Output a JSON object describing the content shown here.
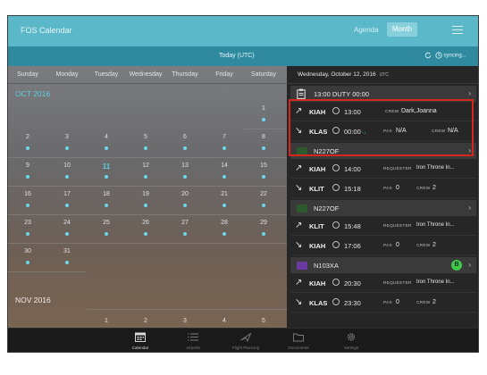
{
  "header": {
    "app_title": "FOS Calendar",
    "nav_agenda": "Agenda",
    "nav_month": "Month",
    "menu_icon": "hamburger-menu-icon"
  },
  "today_bar": {
    "label": "Today (UTC)",
    "sync_text": "syncing..."
  },
  "calendar": {
    "weekdays": [
      "Sunday",
      "Monday",
      "Tuesday",
      "Wednesday",
      "Thursday",
      "Friday",
      "Saturday"
    ],
    "month1_label": "OCT 2016",
    "month2_label": "NOV 2016",
    "today_day": "11",
    "oct_rows": [
      [
        "",
        "",
        "",
        "",
        "",
        "",
        "1"
      ],
      [
        "2",
        "3",
        "4",
        "5",
        "6",
        "7",
        "8"
      ],
      [
        "9",
        "10",
        "11",
        "12",
        "13",
        "14",
        "15"
      ],
      [
        "16",
        "17",
        "18",
        "19",
        "20",
        "21",
        "22"
      ],
      [
        "23",
        "24",
        "25",
        "26",
        "27",
        "28",
        "29"
      ],
      [
        "30",
        "31",
        "",
        "",
        "",
        "",
        ""
      ]
    ],
    "nov_row": [
      "",
      "",
      "1",
      "2",
      "3",
      "4",
      "5"
    ]
  },
  "panel": {
    "date": "Wednesday, October 12, 2016",
    "date_tz": "UTC",
    "duty": {
      "title": "13:00 DUTY 00:00",
      "dep_airport": "KIAH",
      "dep_time": "13:00",
      "crew_label": "CREW",
      "crew_value": "Dark,Joanna",
      "arr_airport": "KLAS",
      "arr_time": "00:00",
      "arr_time_suffix": "+1",
      "pax_label": "PAX",
      "pax_value": "N/A",
      "crew2_label": "CREW",
      "crew2_value": "N/A"
    },
    "flights": [
      {
        "tail": "N227OF",
        "color": "#2e5a2e",
        "badge": "",
        "dep_airport": "KIAH",
        "dep_time": "14:00",
        "req_label": "REQUESTER",
        "req_value": "Iron Throne In...",
        "arr_airport": "KLIT",
        "arr_time": "15:18",
        "pax_label": "PAX",
        "pax_value": "0",
        "crew_label": "CREW",
        "crew_value": "2"
      },
      {
        "tail": "N227OF",
        "color": "#2e5a2e",
        "badge": "",
        "dep_airport": "KLIT",
        "dep_time": "15:48",
        "req_label": "REQUESTER",
        "req_value": "Iron Throne In...",
        "arr_airport": "KIAH",
        "arr_time": "17:06",
        "pax_label": "PAX",
        "pax_value": "0",
        "crew_label": "CREW",
        "crew_value": "2"
      },
      {
        "tail": "N103XA",
        "color": "#6a3aa0",
        "badge": "B",
        "dep_airport": "KIAH",
        "dep_time": "20:30",
        "req_label": "REQUESTER",
        "req_value": "Iron Throne In...",
        "arr_airport": "KLAS",
        "arr_time": "23:30",
        "pax_label": "PAX",
        "pax_value": "0",
        "crew_label": "CREW",
        "crew_value": "2"
      }
    ]
  },
  "tabs": [
    {
      "label": "Calendar",
      "icon": "calendar-icon",
      "active": true
    },
    {
      "label": "Airports",
      "icon": "list-icon",
      "active": false
    },
    {
      "label": "Flight Planning",
      "icon": "plane-icon",
      "active": false
    },
    {
      "label": "Documents",
      "icon": "folder-icon",
      "active": false
    },
    {
      "label": "Settings",
      "icon": "gear-icon",
      "active": false
    }
  ],
  "colors": {
    "accent": "#5bb8c9",
    "accent_dark": "#2f8aa0",
    "today": "#5fd0e0",
    "dot": "#6ad8ec",
    "highlight": "#d7261e",
    "badge": "#3dc946"
  }
}
